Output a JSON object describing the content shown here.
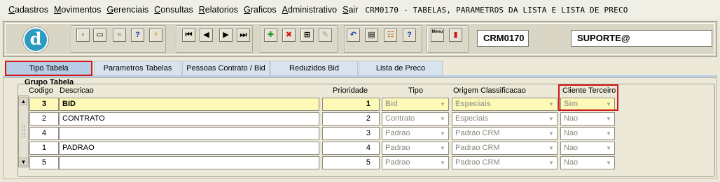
{
  "menubar": {
    "items": [
      {
        "underline": "C",
        "rest": "adastros"
      },
      {
        "underline": "M",
        "rest": "ovimentos"
      },
      {
        "underline": "G",
        "rest": "erenciais"
      },
      {
        "underline": "C",
        "rest": "onsultas"
      },
      {
        "underline": "R",
        "rest": "elatorios"
      },
      {
        "underline": "G",
        "rest": "raficos"
      },
      {
        "underline": "A",
        "rest": "dministrativo"
      },
      {
        "underline": "S",
        "rest": "air"
      }
    ],
    "title": "CRM0170 - TABELAS, PARAMETROS DA LISTA E LISTA DE PRECO"
  },
  "toolbar": {
    "logo_letter": "d",
    "form_code": "CRM0170",
    "user": "SUPORTE@",
    "menu_icon_text": "Menu",
    "help_text": "?"
  },
  "tabs": [
    "Tipo Tabela",
    "Parametros Tabelas",
    "Pessoas Contrato / Bid",
    "Reduzidos Bid",
    "Lista de Preco"
  ],
  "group": {
    "title": "Grupo Tabela",
    "headers": {
      "codigo": "Codigo",
      "descricao": "Descricao",
      "prioridade": "Prioridade",
      "tipo": "Tipo",
      "origem": "Origem Classificacao",
      "cliente": "Cliente Terceiro"
    },
    "rows": [
      {
        "codigo": "3",
        "descricao": "BID",
        "prioridade": "1",
        "tipo": "Bid",
        "origem": "Especiais",
        "cliente": "Sim"
      },
      {
        "codigo": "2",
        "descricao": "CONTRATO",
        "prioridade": "2",
        "tipo": "Contrato",
        "origem": "Especiais",
        "cliente": "Nao"
      },
      {
        "codigo": "4",
        "descricao": "",
        "prioridade": "3",
        "tipo": "Padrao",
        "origem": "Padrao CRM",
        "cliente": "Nao"
      },
      {
        "codigo": "1",
        "descricao": "PADRAO",
        "prioridade": "4",
        "tipo": "Padrao",
        "origem": "Padrao CRM",
        "cliente": "Nao"
      },
      {
        "codigo": "5",
        "descricao": "",
        "prioridade": "5",
        "tipo": "Padrao",
        "origem": "Padrao CRM",
        "cliente": "Nao"
      }
    ]
  },
  "colors": {
    "selected_row": "#fdf9b6",
    "highlight": "#d01818",
    "tab_active": "#b7cde6"
  }
}
